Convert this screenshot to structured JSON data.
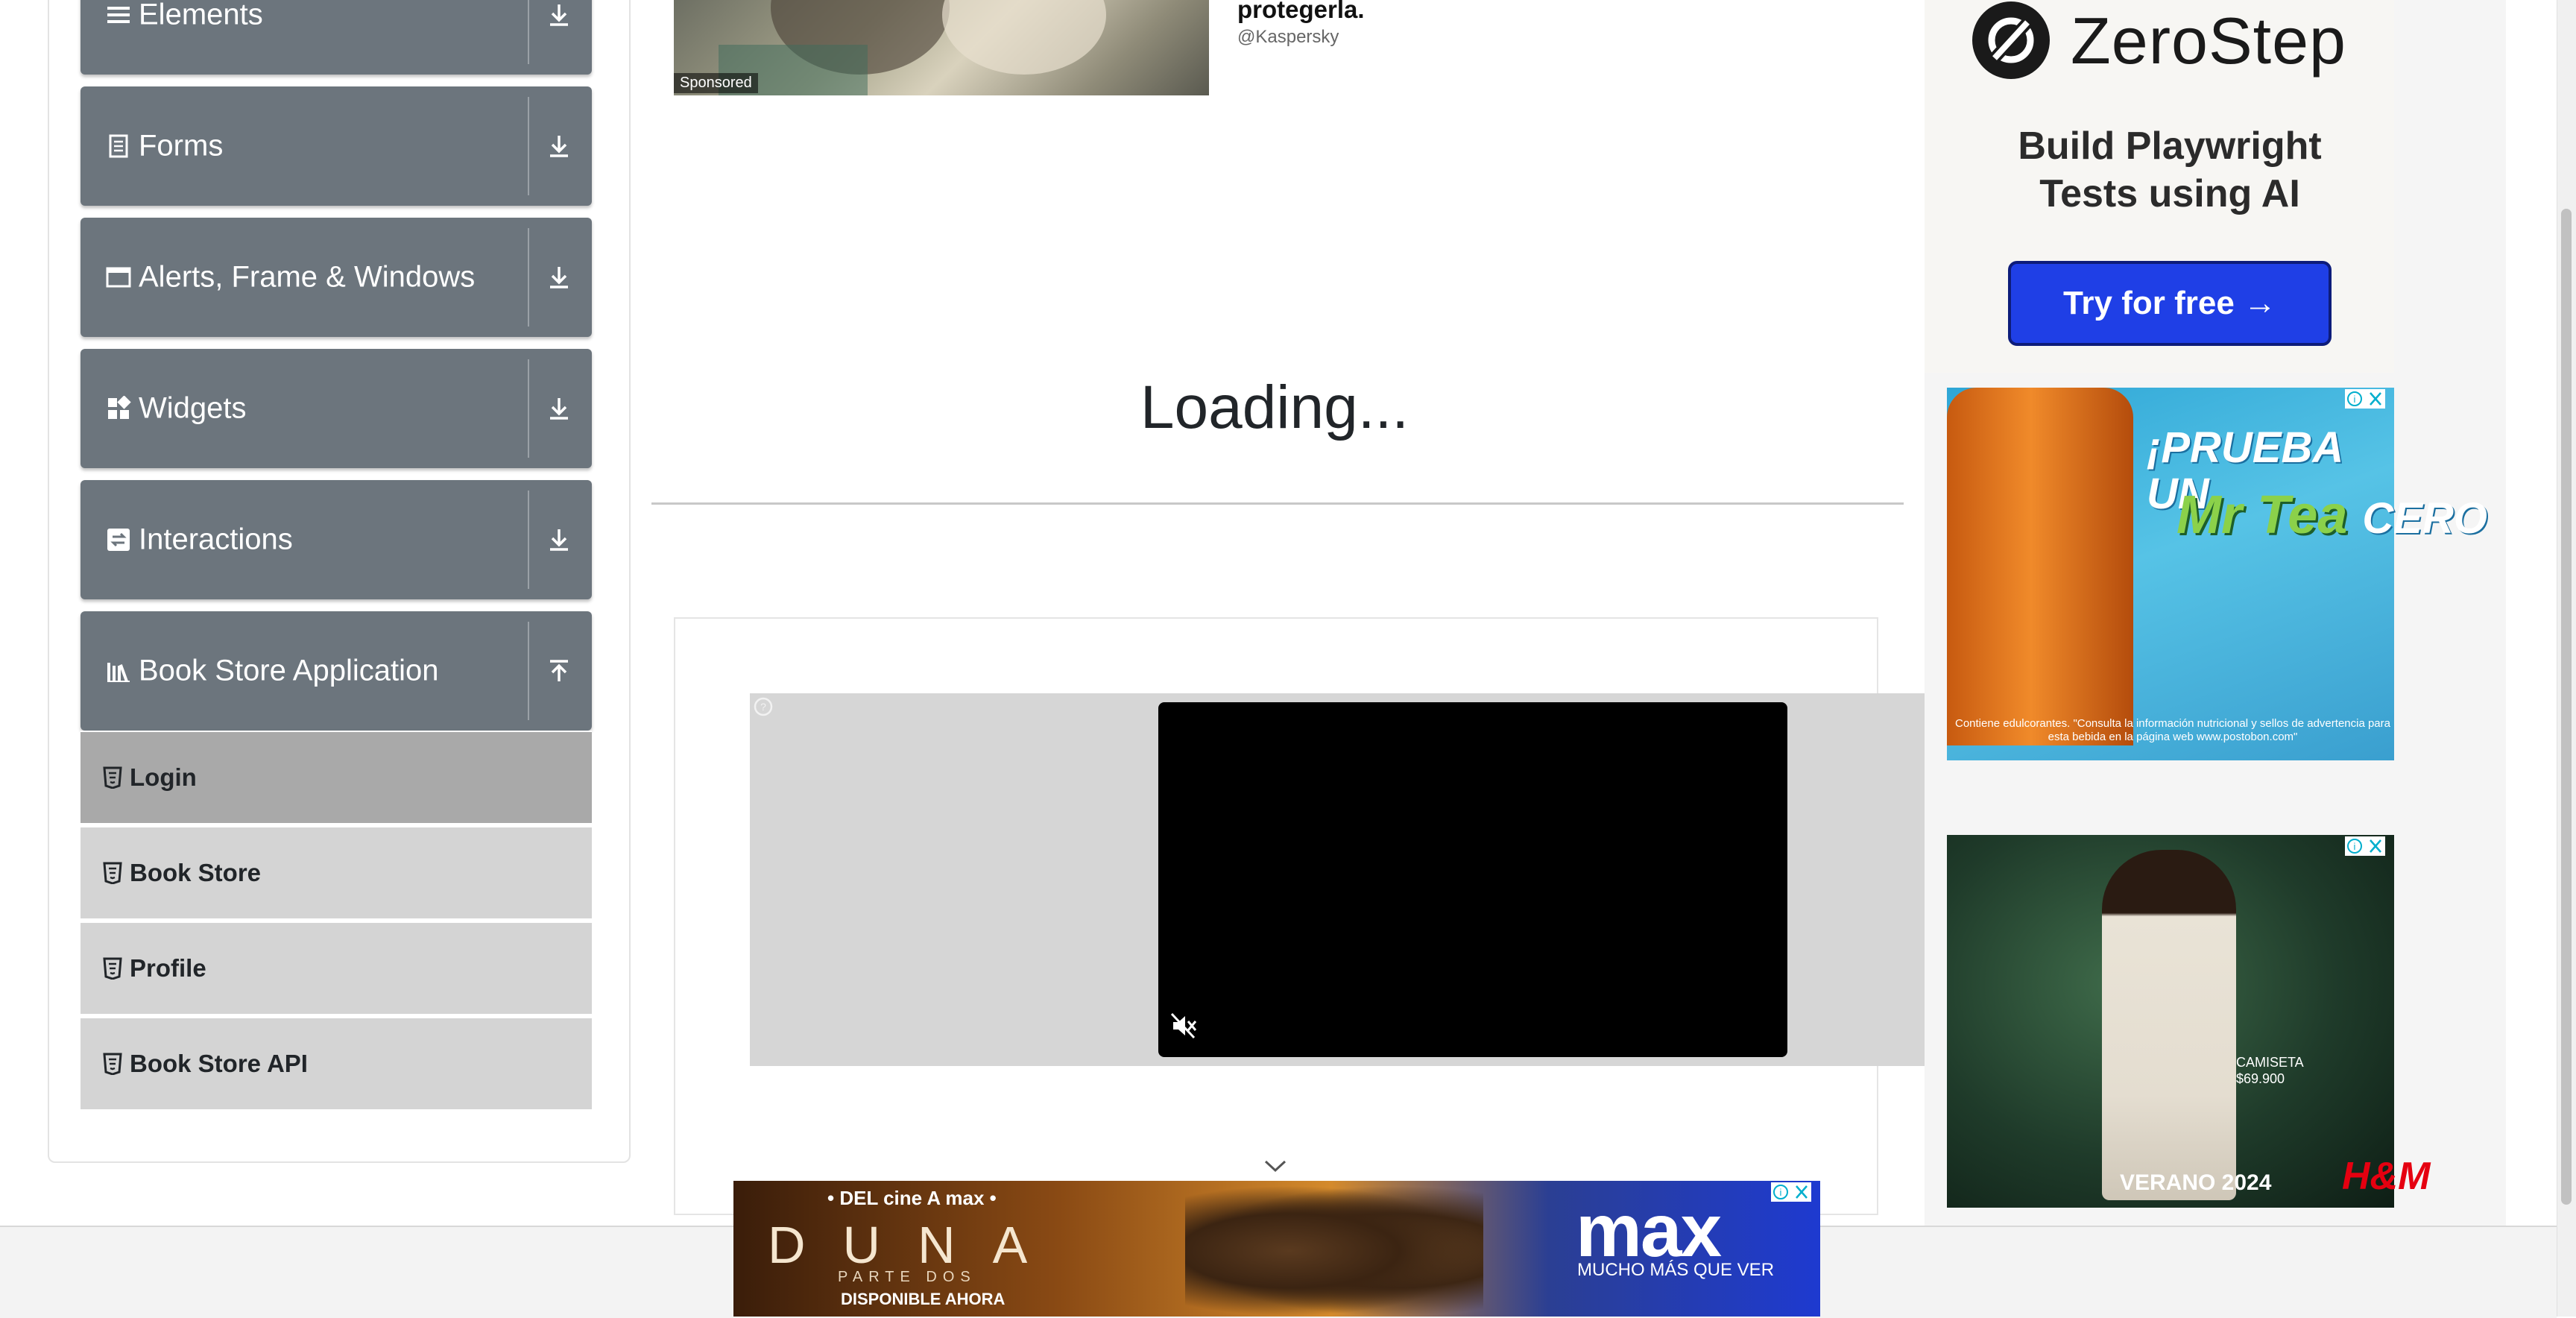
{
  "sidebar": {
    "groups": [
      {
        "label": "Elements",
        "icon": "list-icon",
        "expanded": false
      },
      {
        "label": "Forms",
        "icon": "document-icon",
        "expanded": false
      },
      {
        "label": "Alerts, Frame & Windows",
        "icon": "window-icon",
        "expanded": false
      },
      {
        "label": "Widgets",
        "icon": "widgets-icon",
        "expanded": false
      },
      {
        "label": "Interactions",
        "icon": "interactions-icon",
        "expanded": false
      },
      {
        "label": "Book Store Application",
        "icon": "books-icon",
        "expanded": true
      }
    ],
    "sub_items": [
      {
        "label": "Login",
        "active": true
      },
      {
        "label": "Book Store",
        "active": false
      },
      {
        "label": "Profile",
        "active": false
      },
      {
        "label": "Book Store API",
        "active": false
      }
    ]
  },
  "main": {
    "promo": {
      "sponsored_label": "Sponsored",
      "title": "protegerla.",
      "handle": "@Kaspersky"
    },
    "loading_text": "Loading..."
  },
  "ads": {
    "zerostep": {
      "brand": "ZeroStep",
      "tagline": "Build Playwright Tests using AI",
      "cta": "Try for free →"
    },
    "tea": {
      "headline": "¡PRUEBA UN",
      "brand": "Mr Tea",
      "suffix": "CERO",
      "disclaimer": "Contiene edulcorantes. \"Consulta la información nutricional y sellos de advertencia para esta bebida en la página web www.postobon.com\""
    },
    "hm": {
      "price_line1": "CAMISETA",
      "price_line2": "$69.900",
      "season": "VERANO 2024",
      "logo": "H&M"
    },
    "banner": {
      "top": "• DEL cine A max •",
      "title": "DUNA",
      "subtitle": "PARTE DOS",
      "availability": "DISPONIBLE AHORA",
      "brand": "max",
      "brand_sub": "MUCHO MÁS QUE VER"
    }
  },
  "colors": {
    "sidebar_header": "#6c757d",
    "sub_item": "#d4d4d4",
    "sub_item_active": "#a9a9a9",
    "zerostep_button": "#1f3fe6",
    "hm_logo": "#e50010"
  }
}
